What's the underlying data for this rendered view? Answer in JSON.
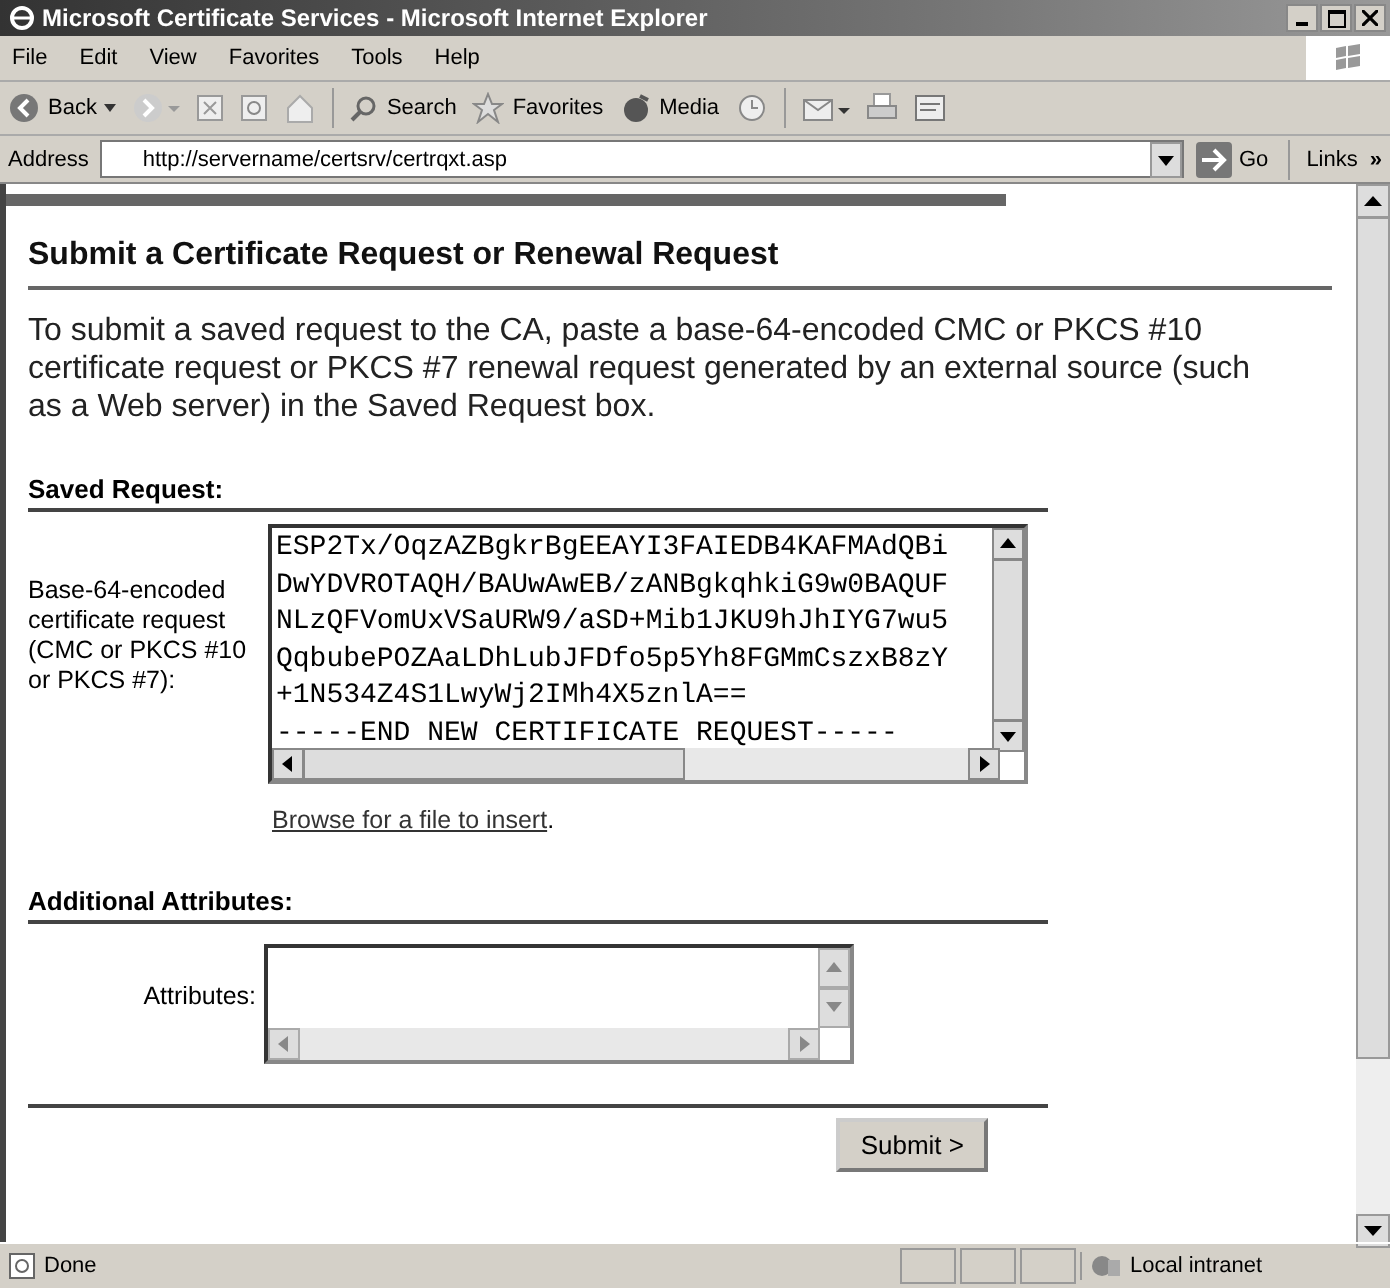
{
  "window": {
    "title": "Microsoft Certificate Services - Microsoft Internet Explorer"
  },
  "menu": [
    {
      "label": "File"
    },
    {
      "label": "Edit"
    },
    {
      "label": "View"
    },
    {
      "label": "Favorites"
    },
    {
      "label": "Tools"
    },
    {
      "label": "Help"
    }
  ],
  "toolbar": {
    "back": "Back",
    "search": "Search",
    "favorites": "Favorites",
    "media": "Media"
  },
  "address_bar": {
    "label": "Address",
    "url": "http://servername/certsrv/certrqxt.asp",
    "go": "Go",
    "links": "Links",
    "more": "»"
  },
  "page": {
    "heading": "Submit a Certificate Request or Renewal Request",
    "intro": "To submit a saved request to the CA, paste a base-64-encoded CMC or PKCS #10 certificate request or PKCS #7 renewal request generated by an external source (such as a Web server) in the Saved Request box.",
    "saved_request": {
      "heading": "Saved Request:",
      "label": "Base-64-encoded certificate request (CMC or PKCS #10 or PKCS #7):",
      "value": "ESP2Tx/OqzAZBgkrBgEEAYI3FAIEDB4KAFMAdQBi\nDwYDVROTAQH/BAUwAwEB/zANBgkqhkiG9w0BAQUF\nNLzQFVomUxVSaURW9/aSD+Mib1JKU9hJhIYG7wu5\nQqbubePOZAaLDhLubJFDfo5p5Yh8FGMmCszxB8zY\n+1N534Z4S1LwyWj2IMh4X5znlA==\n-----END NEW CERTIFICATE REQUEST-----",
      "browse_link": "Browse for a file to insert",
      "browse_period": "."
    },
    "additional": {
      "heading": "Additional Attributes:",
      "label": "Attributes:"
    },
    "submit": "Submit >"
  },
  "status_bar": {
    "text": "Done",
    "zone": "Local intranet"
  }
}
